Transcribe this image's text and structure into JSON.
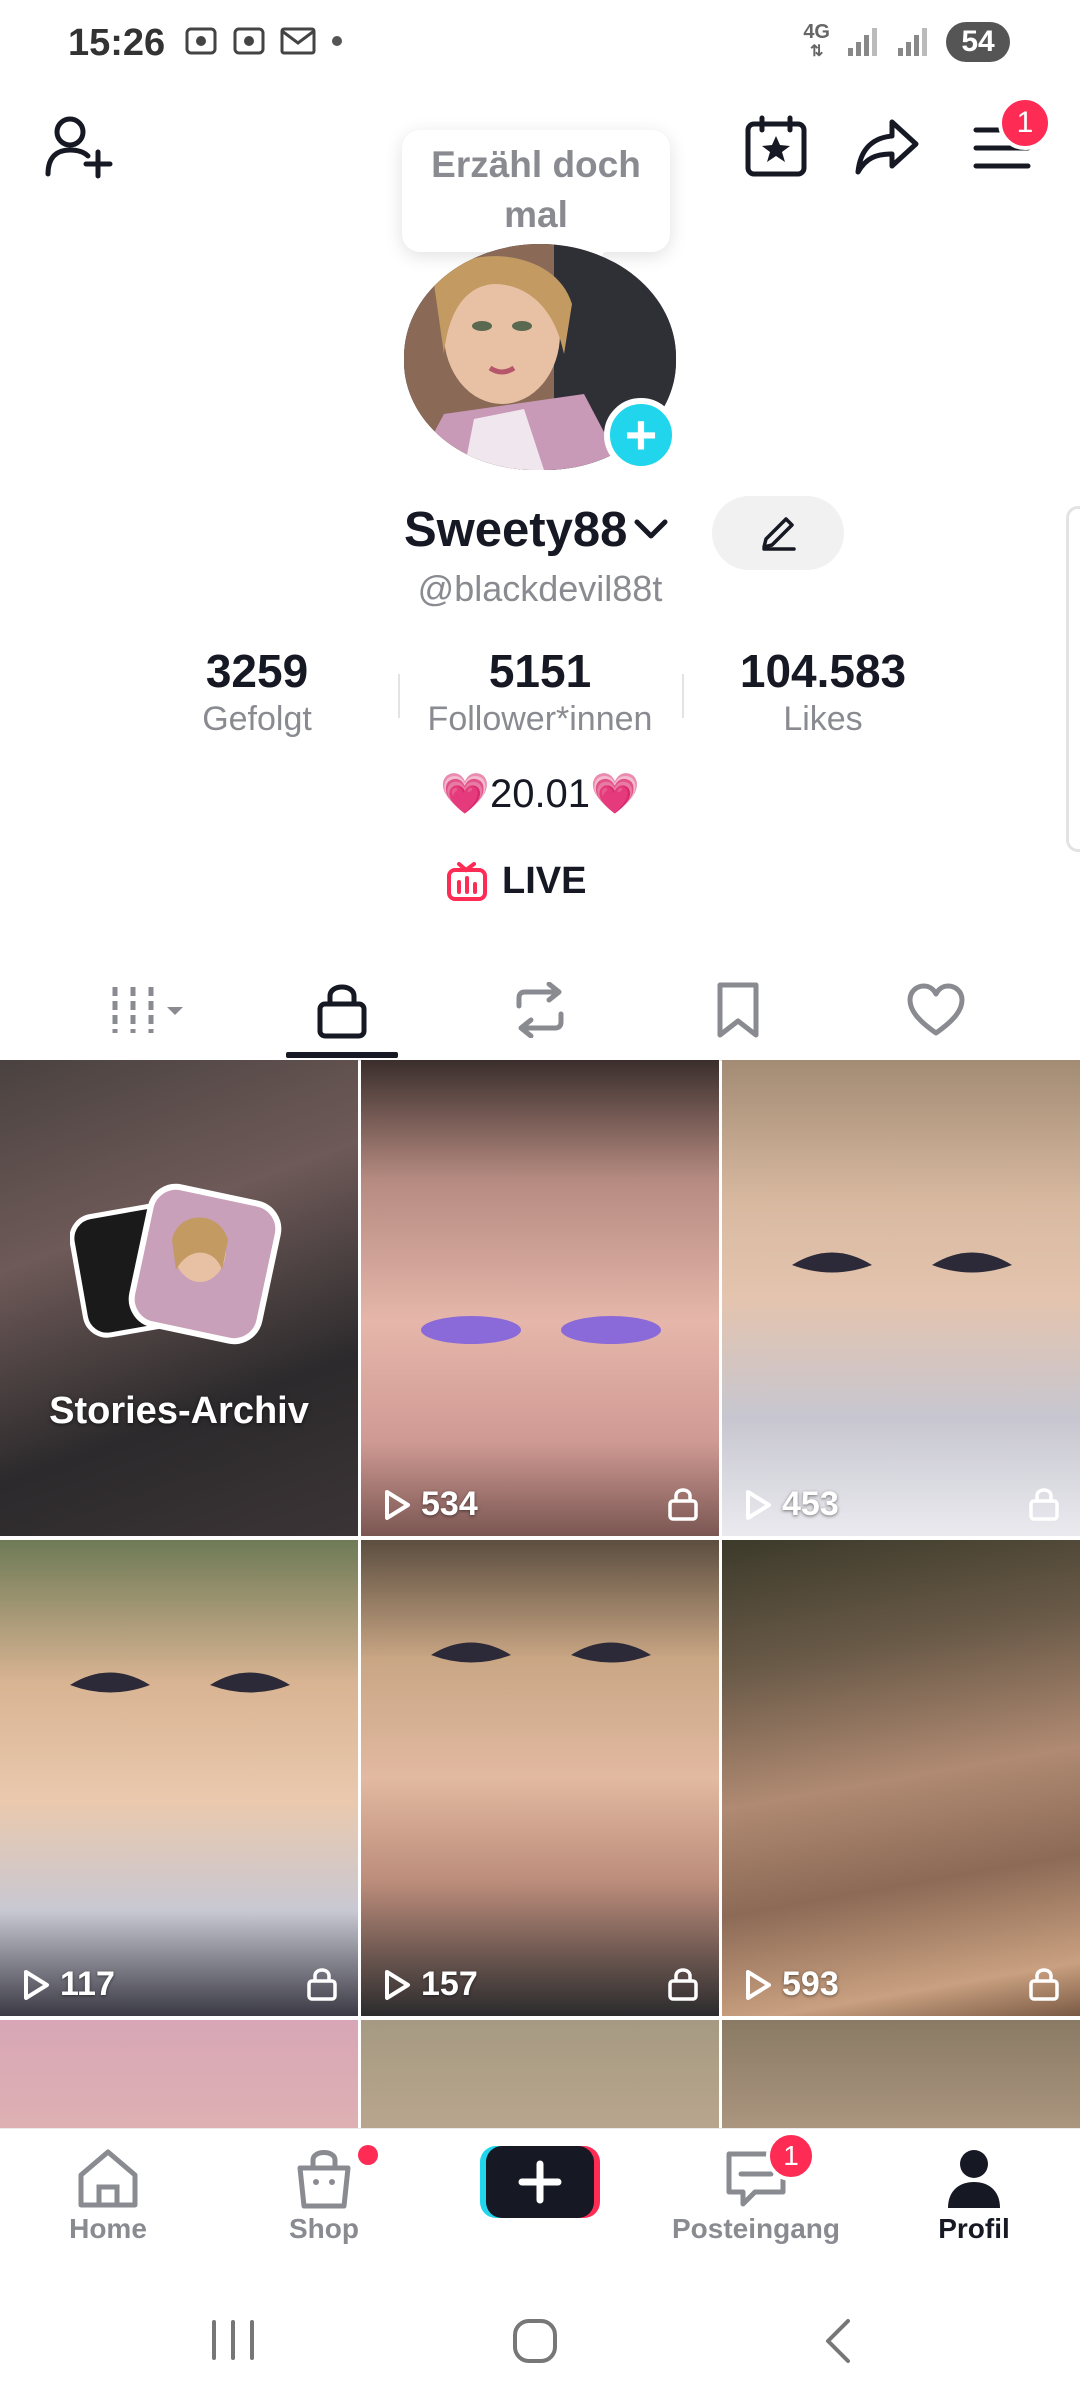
{
  "status_bar": {
    "time": "15:26",
    "network": "4G",
    "battery": "54"
  },
  "header": {
    "notification_badge": "1",
    "bubble_text": "Erzähl doch mal"
  },
  "profile": {
    "display_name": "Sweety88",
    "handle": "@blackdevil88t",
    "bio": "💗20.01💗",
    "live_label": "LIVE"
  },
  "stats": [
    {
      "value": "3259",
      "label": "Gefolgt"
    },
    {
      "value": "5151",
      "label": "Follower*innen"
    },
    {
      "value": "104.583",
      "label": "Likes"
    }
  ],
  "tabs": [
    {
      "icon": "grid-icon"
    },
    {
      "icon": "lock-icon",
      "active": true
    },
    {
      "icon": "repost-icon"
    },
    {
      "icon": "bookmark-icon"
    },
    {
      "icon": "heart-icon"
    }
  ],
  "grid": {
    "stories_label": "Stories-Archiv",
    "videos": [
      {
        "views": "534",
        "private": true
      },
      {
        "views": "453",
        "private": true
      },
      {
        "views": "117",
        "private": true
      },
      {
        "views": "157",
        "private": true
      },
      {
        "views": "593",
        "private": true
      }
    ]
  },
  "bottom_nav": {
    "home": "Home",
    "shop": "Shop",
    "inbox": "Posteingang",
    "inbox_badge": "1",
    "profile": "Profil"
  },
  "colors": {
    "accent": "#fe2c55",
    "cyan": "#20d5ec",
    "text": "#161823",
    "muted": "#8a8b91"
  }
}
